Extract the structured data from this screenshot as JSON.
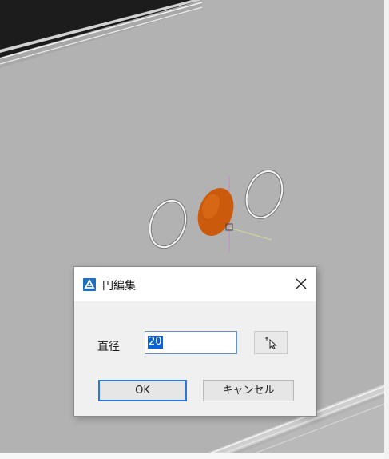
{
  "dialog": {
    "title": "円編集",
    "diameter_label": "直径",
    "diameter_value": "20",
    "ok_label": "OK",
    "cancel_label": "キャンセル"
  },
  "colors": {
    "accent": "#2a79d6",
    "selection": "#0a64d6",
    "filled_circle": "#cc5a0c",
    "app_icon": "#1e6fbf"
  },
  "icons": {
    "app": "app-logo-icon",
    "close": "close-icon",
    "pick": "pick-point-cursor-icon"
  }
}
